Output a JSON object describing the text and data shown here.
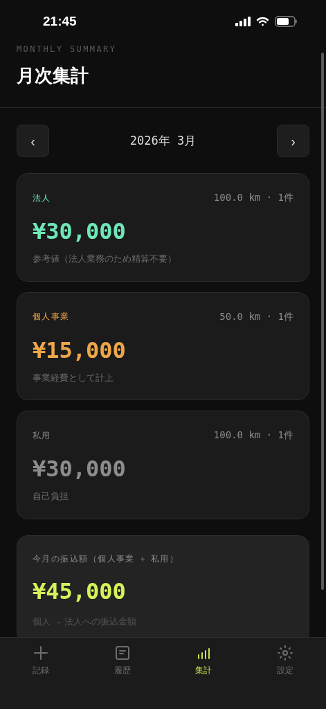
{
  "status_bar": {
    "time": "21:45"
  },
  "header": {
    "subtitle": "MONTHLY SUMMARY",
    "title": "月次集計"
  },
  "month_nav": {
    "prev": "‹",
    "label": "2026年 3月",
    "next": "›"
  },
  "cards": [
    {
      "kind": "category",
      "label": "法人",
      "meta": "100.0 km · 1件",
      "amount": "¥30,000",
      "note": "参考値（法人業務のため精算不要）",
      "color": "#6ee7b7"
    },
    {
      "kind": "category",
      "label": "個人事業",
      "meta": "50.0 km · 1件",
      "amount": "¥15,000",
      "note": "事業経費として計上",
      "color": "#eda64a"
    },
    {
      "kind": "category",
      "label": "私用",
      "meta": "100.0 km · 1件",
      "amount": "¥30,000",
      "note": "自己負担",
      "color": "#8c8c8c"
    },
    {
      "kind": "transfer",
      "label": "今月の振込額（個人事業 ＋ 私用）",
      "amount": "¥45,000",
      "note": "個人 → 法人への振込金額",
      "color": "#d4f25a"
    }
  ],
  "tab_bar": [
    {
      "label": "記録",
      "selected": false
    },
    {
      "label": "履歴",
      "selected": false
    },
    {
      "label": "集計",
      "selected": true
    },
    {
      "label": "設定",
      "selected": false
    }
  ]
}
